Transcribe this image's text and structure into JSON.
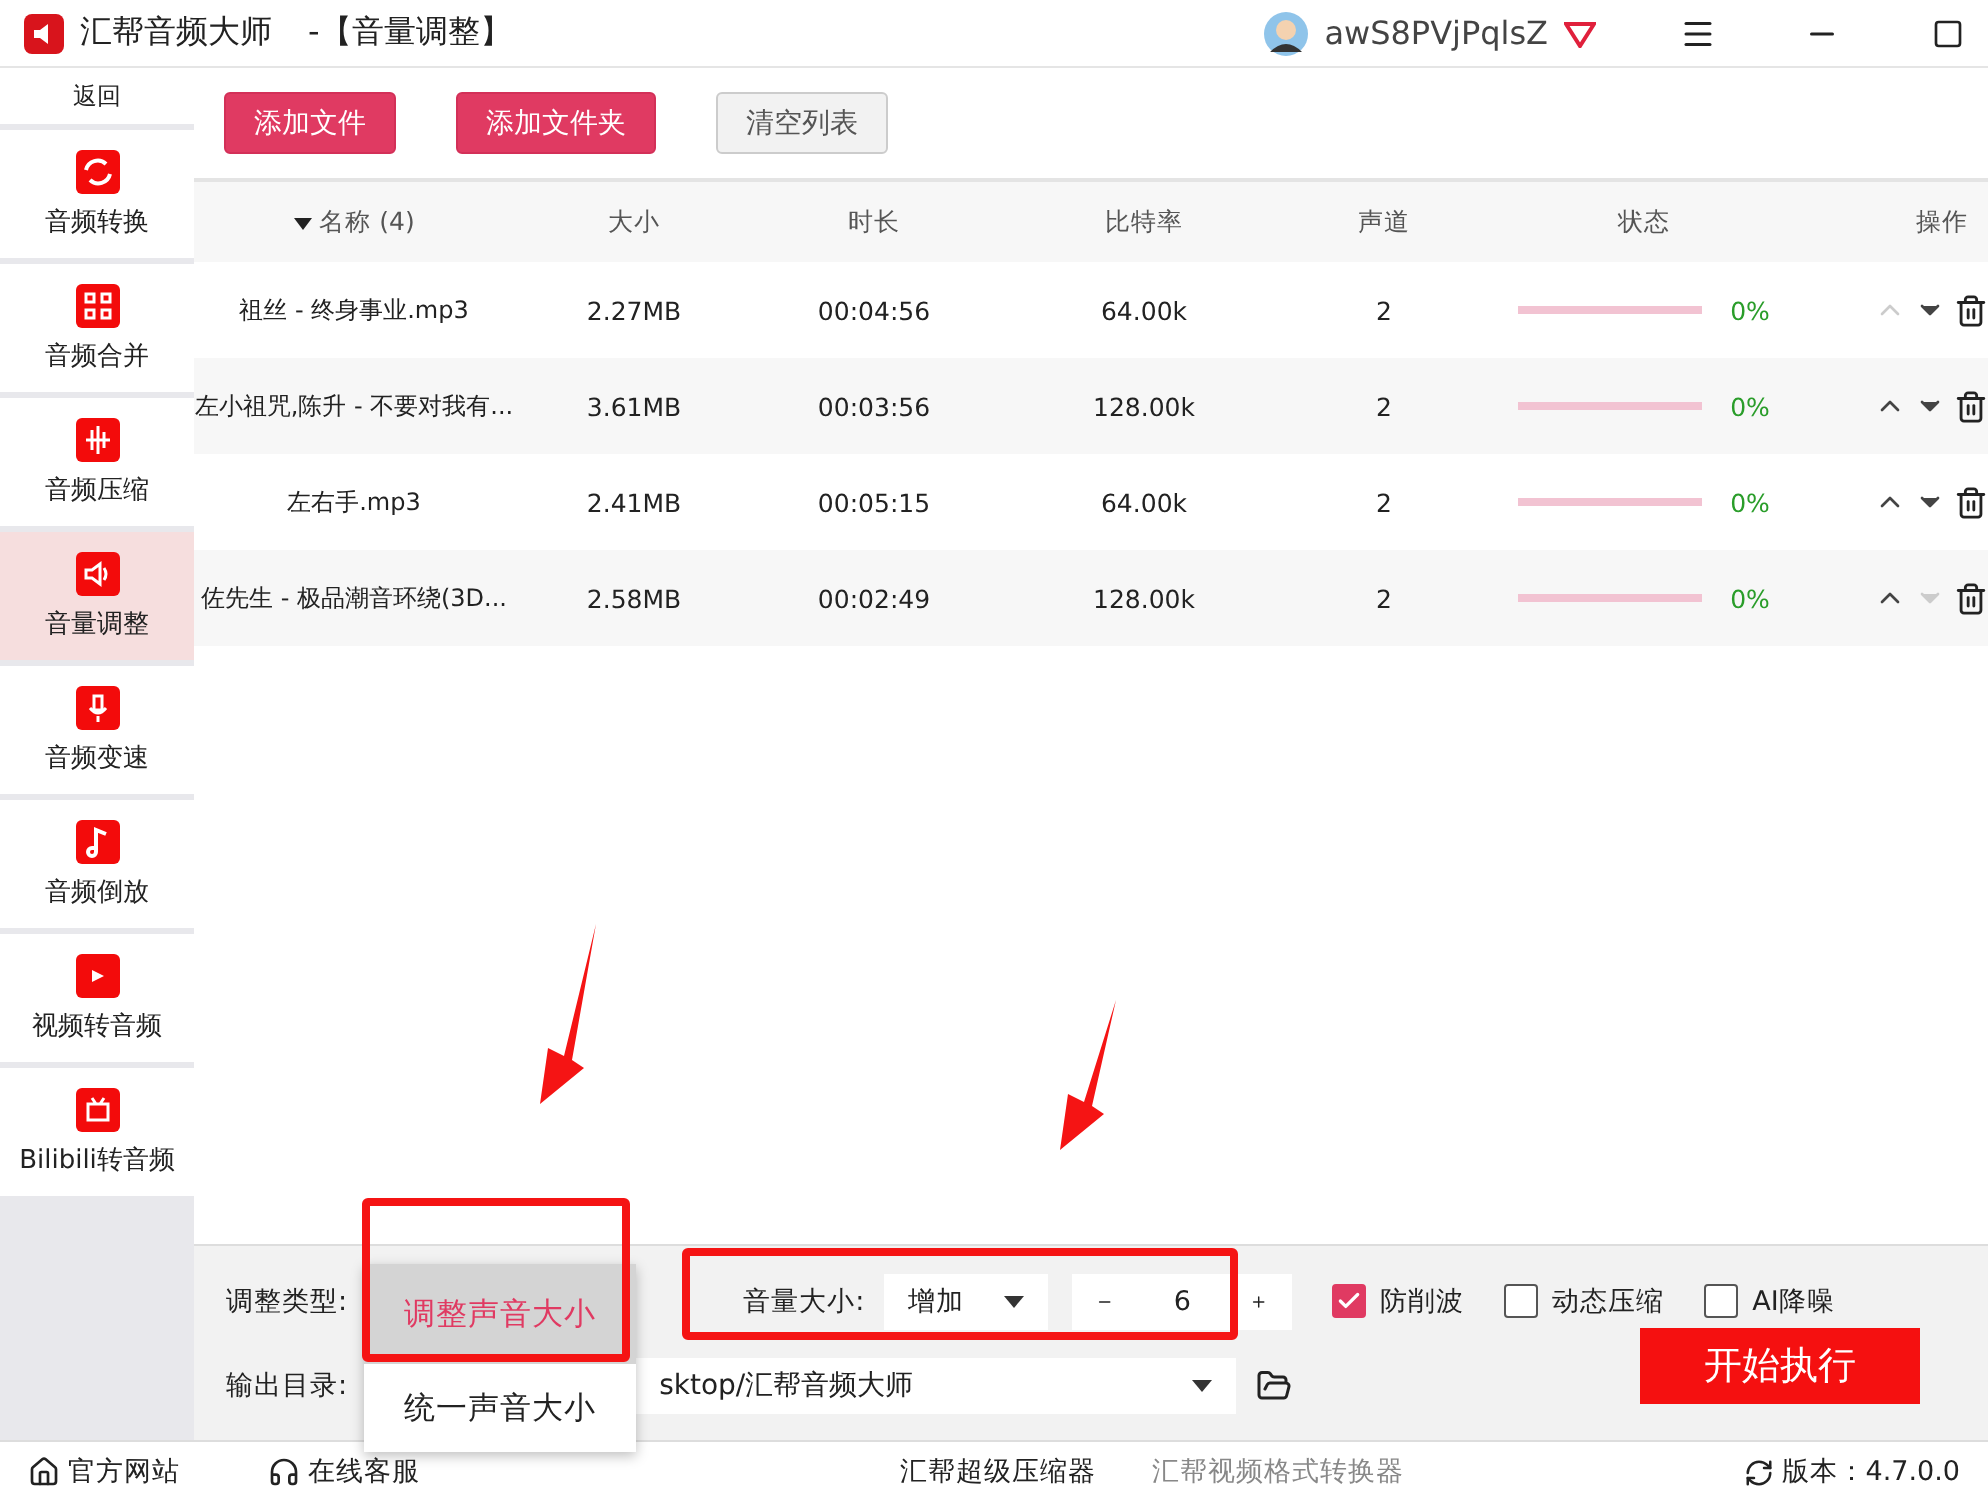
{
  "window": {
    "app_name": "汇帮音频大师",
    "title": "-【音量调整】",
    "username": "awS8PVjPqlsZ"
  },
  "sidebar": {
    "back": "返回",
    "items": [
      {
        "label": "音频转换",
        "selected": false,
        "kind": "convert"
      },
      {
        "label": "音频合并",
        "selected": false,
        "kind": "merge"
      },
      {
        "label": "音频压缩",
        "selected": false,
        "kind": "compress"
      },
      {
        "label": "音量调整",
        "selected": true,
        "kind": "volume"
      },
      {
        "label": "音频变速",
        "selected": false,
        "kind": "mic"
      },
      {
        "label": "音频倒放",
        "selected": false,
        "kind": "note"
      },
      {
        "label": "视频转音频",
        "selected": false,
        "kind": "film"
      },
      {
        "label": "Bilibili转音频",
        "selected": false,
        "kind": "tv"
      }
    ]
  },
  "toolbar": {
    "buttons": [
      {
        "label": "添加文件",
        "kind": "primary"
      },
      {
        "label": "添加文件夹",
        "kind": "primary"
      },
      {
        "label": "清空列表",
        "kind": "secondary"
      }
    ]
  },
  "table": {
    "columns": [
      "名称 (4)",
      "大小",
      "时长",
      "比特率",
      "声道",
      "状态",
      "操作"
    ],
    "rows": [
      {
        "name": "祖丝 - 终身事业.mp3",
        "size": "2.27MB",
        "duration": "00:04:56",
        "bitrate": "64.00k",
        "channels": "2",
        "level": 0,
        "progress": "0%",
        "up_enabled": false,
        "down_enabled": true
      },
      {
        "name": "左小祖咒,陈升 - 不要对我有...",
        "size": "3.61MB",
        "duration": "00:03:56",
        "bitrate": "128.00k",
        "channels": "2",
        "level": 0,
        "progress": "0%",
        "up_enabled": true,
        "down_enabled": true
      },
      {
        "name": "左右手.mp3",
        "size": "2.41MB",
        "duration": "00:05:15",
        "bitrate": "64.00k",
        "channels": "2",
        "level": 0,
        "progress": "0%",
        "up_enabled": true,
        "down_enabled": true
      },
      {
        "name": "佐先生 - 极品潮音环绕(3D...",
        "size": "2.58MB",
        "duration": "00:02:49",
        "bitrate": "128.00k",
        "channels": "2",
        "level": 0,
        "progress": "0%",
        "up_enabled": true,
        "down_enabled": false
      }
    ]
  },
  "settings": {
    "type_label": "调整类型:",
    "type_options": [
      {
        "label": "调整声音大小",
        "selected": true
      },
      {
        "label": "统一声音大小",
        "selected": false
      }
    ],
    "volume_label": "音量大小:",
    "volume_mode": "增加",
    "volume_value": "6",
    "checkboxes": [
      {
        "label": "防削波",
        "checked": true
      },
      {
        "label": "动态压缩",
        "checked": false
      },
      {
        "label": "AI降噪",
        "checked": false
      }
    ],
    "output_label": "输出目录:",
    "output_path": "sktop/汇帮音频大师",
    "start_button": "开始执行"
  },
  "status_bar": {
    "website": "官方网站",
    "support": "在线客服",
    "links": [
      {
        "label": "汇帮超级压缩器",
        "selected": true
      },
      {
        "label": "汇帮视频格式转换器",
        "selected": false
      }
    ],
    "version": "版本：4.7.0.0"
  }
}
